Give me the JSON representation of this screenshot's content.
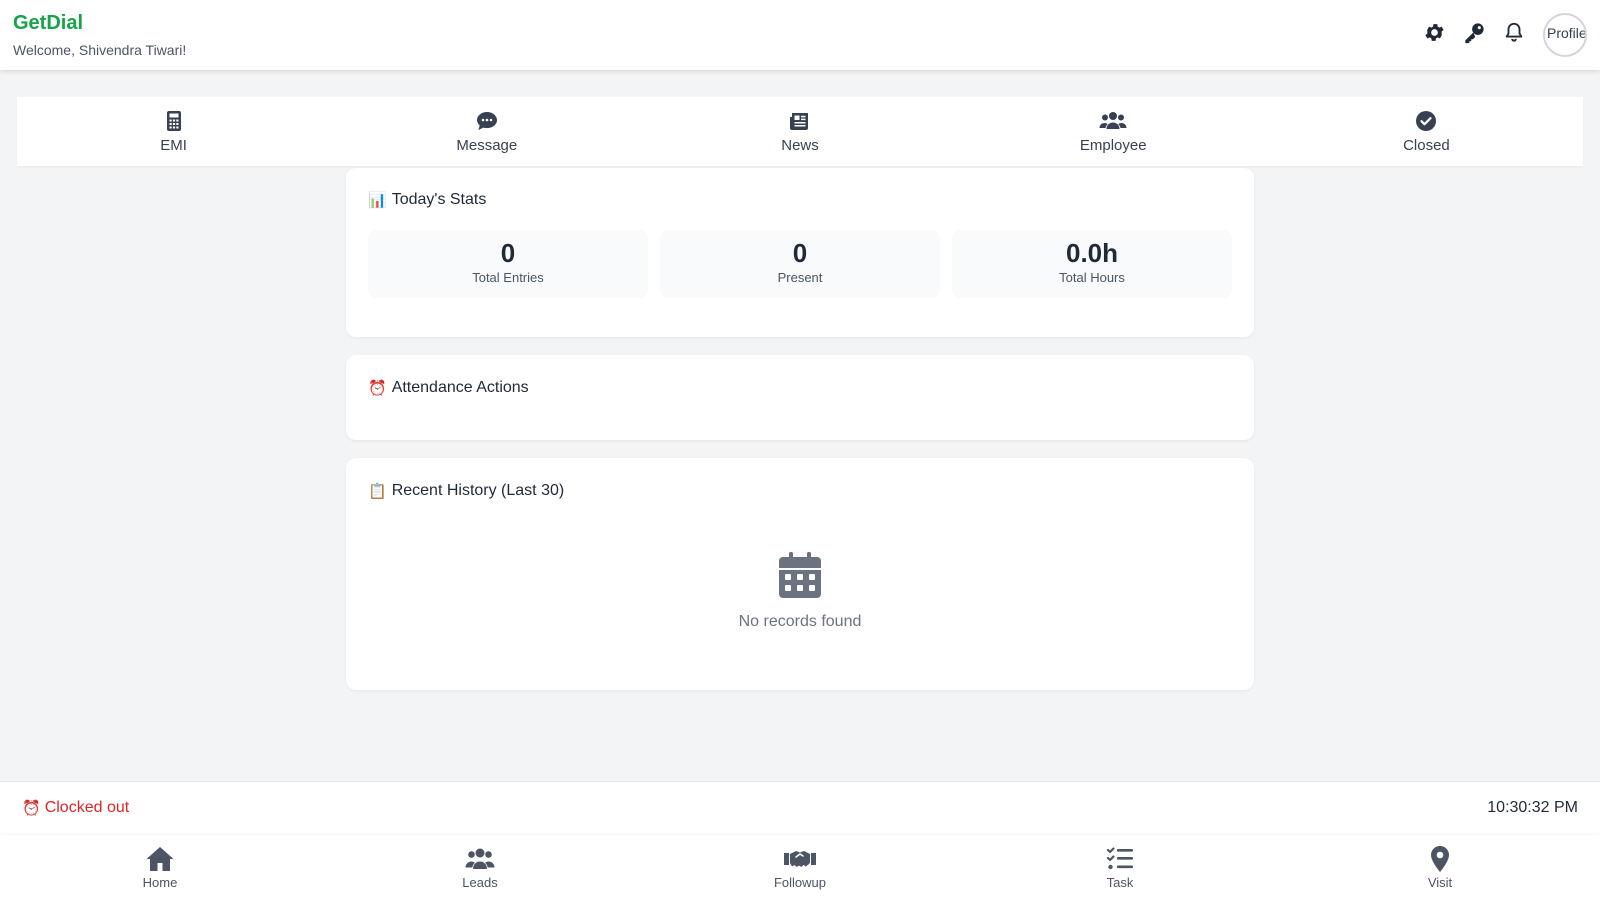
{
  "header": {
    "brand": "GetDial",
    "welcome": "Welcome, Shivendra Tiwari!",
    "avatar_alt": "Profile",
    "brand_color": "#16a34a",
    "icons": [
      "gear-icon",
      "key-icon",
      "bell-icon"
    ]
  },
  "topnav": {
    "items": [
      {
        "label": "EMI",
        "icon": "calculator-icon"
      },
      {
        "label": "Message",
        "icon": "chat-bubble-icon"
      },
      {
        "label": "News",
        "icon": "newspaper-icon"
      },
      {
        "label": "Employee",
        "icon": "users-icon"
      },
      {
        "label": "Closed",
        "icon": "check-circle-icon"
      }
    ]
  },
  "stats": {
    "title": "Today's Stats",
    "emoji": "📊",
    "items": [
      {
        "value": "0",
        "label": "Total Entries"
      },
      {
        "value": "0",
        "label": "Present"
      },
      {
        "value": "0.0h",
        "label": "Total Hours"
      }
    ]
  },
  "attendance": {
    "title": "Attendance Actions",
    "emoji": "⏰"
  },
  "history": {
    "title": "Recent History (Last 30)",
    "emoji": "📋",
    "empty_text": "No records found",
    "empty_icon": "calendar-icon"
  },
  "status": {
    "text": "Clocked out",
    "emoji": "⏰",
    "time": "10:30:32 PM",
    "color": "#dc2626"
  },
  "bottomnav": {
    "items": [
      {
        "label": "Home",
        "icon": "home-icon"
      },
      {
        "label": "Leads",
        "icon": "users-icon"
      },
      {
        "label": "Followup",
        "icon": "handshake-icon"
      },
      {
        "label": "Task",
        "icon": "tasks-icon"
      },
      {
        "label": "Visit",
        "icon": "map-pin-icon"
      }
    ]
  }
}
